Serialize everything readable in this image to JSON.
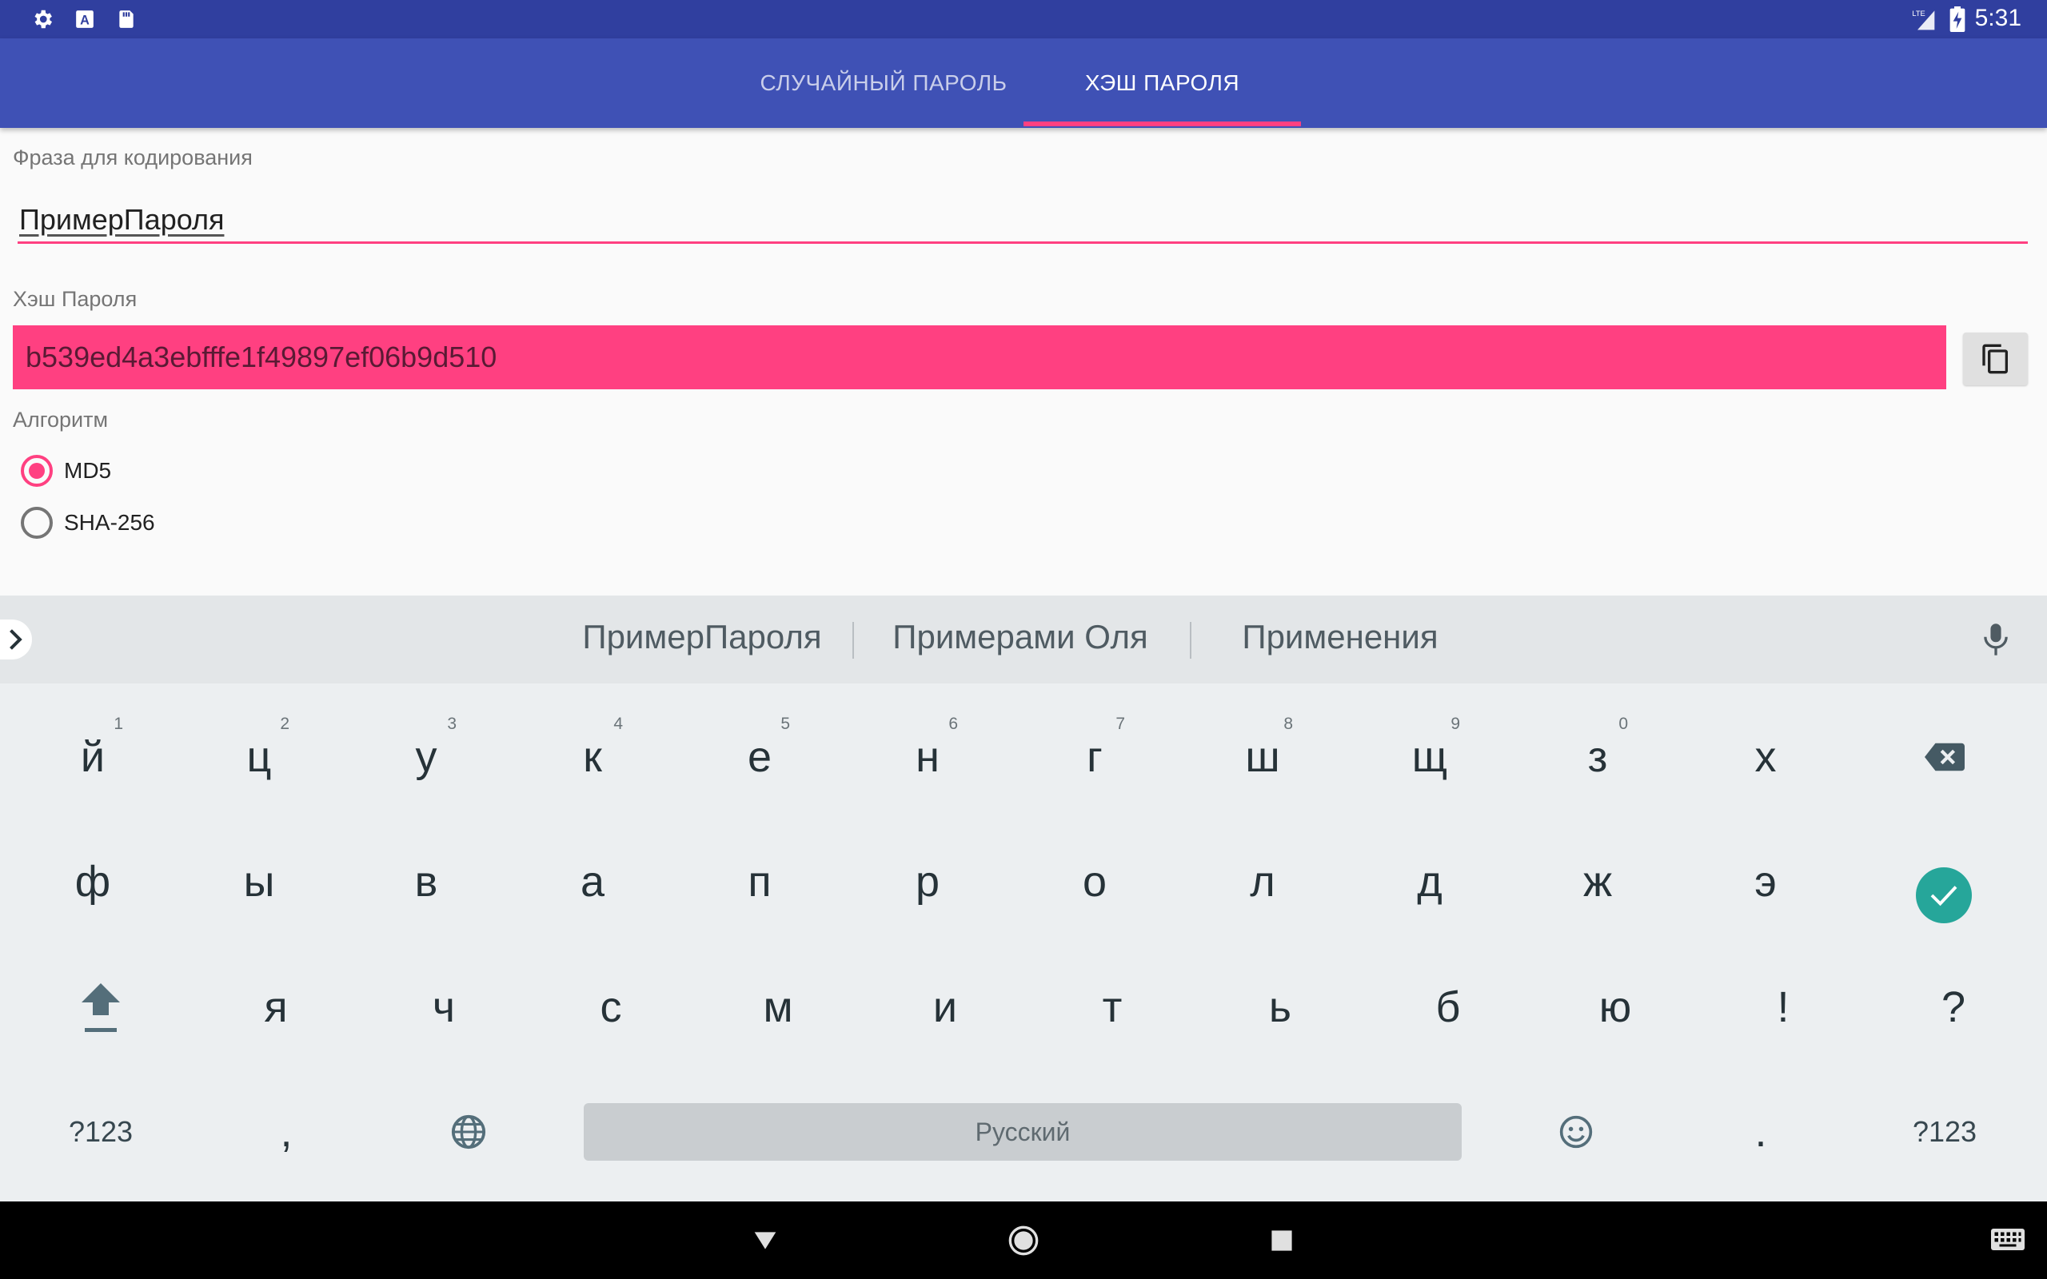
{
  "status_bar": {
    "time": "5:31",
    "left_icons": [
      "settings-icon",
      "text-a-icon",
      "sd-card-icon"
    ],
    "network_label": "LTE"
  },
  "tabs": [
    {
      "label": "СЛУЧАЙНЫЙ ПАРОЛЬ",
      "selected": false
    },
    {
      "label": "ХЭШ ПАРОЛЯ",
      "selected": true
    }
  ],
  "form": {
    "phrase_label": "Фраза для кодирования",
    "phrase_value": "ПримерПароля",
    "hash_label": "Хэш Пароля",
    "hash_value": "b539ed4a3ebfffe1f49897ef06b9d510",
    "algorithm_label": "Алгоритм",
    "algorithms": [
      {
        "label": "MD5",
        "checked": true
      },
      {
        "label": "SHA-256",
        "checked": false
      }
    ]
  },
  "keyboard": {
    "suggestions": [
      "ПримерПароля",
      "Примерами Оля",
      "Применения"
    ],
    "row1": [
      "й",
      "ц",
      "у",
      "к",
      "е",
      "н",
      "г",
      "ш",
      "щ",
      "з",
      "х"
    ],
    "row1_hints": [
      "1",
      "2",
      "3",
      "4",
      "5",
      "6",
      "7",
      "8",
      "9",
      "0"
    ],
    "row2": [
      "ф",
      "ы",
      "в",
      "а",
      "п",
      "р",
      "о",
      "л",
      "д",
      "ж",
      "э"
    ],
    "row3": [
      "я",
      "ч",
      "с",
      "м",
      "и",
      "т",
      "ь",
      "б",
      "ю",
      "!",
      "?"
    ],
    "symbols_left": "?123",
    "comma": ",",
    "space_label": "Русский",
    "period": ".",
    "symbols_right": "?123"
  },
  "colors": {
    "status_bar": "#303f9f",
    "app_bar": "#3f51b5",
    "accent": "#ff4081",
    "enter_key": "#26a69a"
  }
}
